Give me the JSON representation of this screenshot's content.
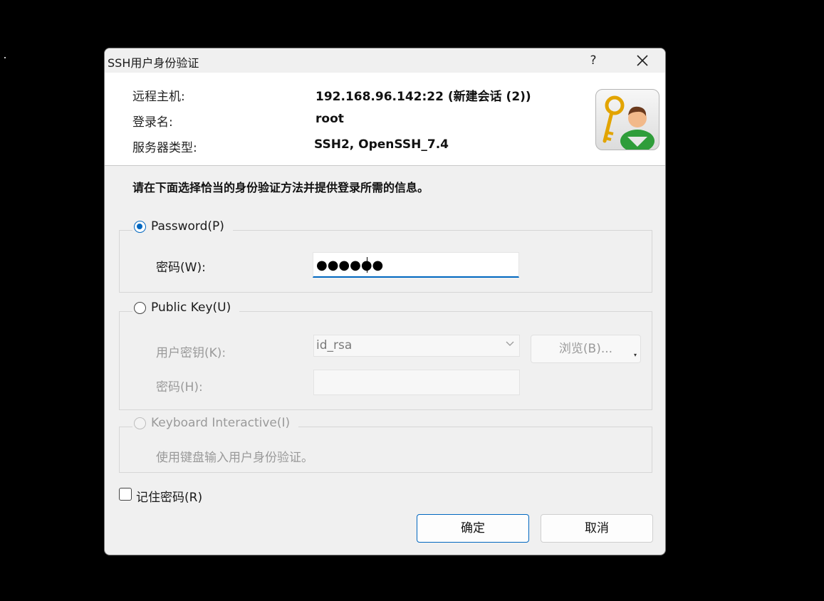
{
  "window": {
    "title": "SSH用户身份验证",
    "help_label": "?",
    "close_icon": "close-icon"
  },
  "info": {
    "remote_host_label": "远程主机:",
    "remote_host_value": "192.168.96.142:22 (新建会话 (2))",
    "login_label": "登录名:",
    "login_value": "root",
    "server_type_label": "服务器类型:",
    "server_type_value": "SSH2, OpenSSH_7.4",
    "icon": "key-user-icon"
  },
  "instruction": "请在下面选择恰当的身份验证方法并提供登录所需的信息。",
  "password_group": {
    "radio_label": "Password(P)",
    "selected": true,
    "field_label": "密码(W):",
    "field_value": "●●●●●●"
  },
  "publickey_group": {
    "radio_label": "Public Key(U)",
    "selected": false,
    "key_label": "用户密钥(K):",
    "key_value": "id_rsa",
    "browse_label": "浏览(B)...",
    "browse_indicator": "▾",
    "passphrase_label": "密码(H):",
    "passphrase_value": ""
  },
  "keyboard_group": {
    "radio_label": "Keyboard Interactive(I)",
    "description": "使用键盘输入用户身份验证。",
    "enabled": false
  },
  "remember": {
    "label": "记住密码(R)",
    "checked": false
  },
  "buttons": {
    "ok": "确定",
    "cancel": "取消"
  },
  "colors": {
    "accent": "#0067c0",
    "dialog_bg": "#f0f0f0",
    "info_bg": "#ffffff"
  }
}
